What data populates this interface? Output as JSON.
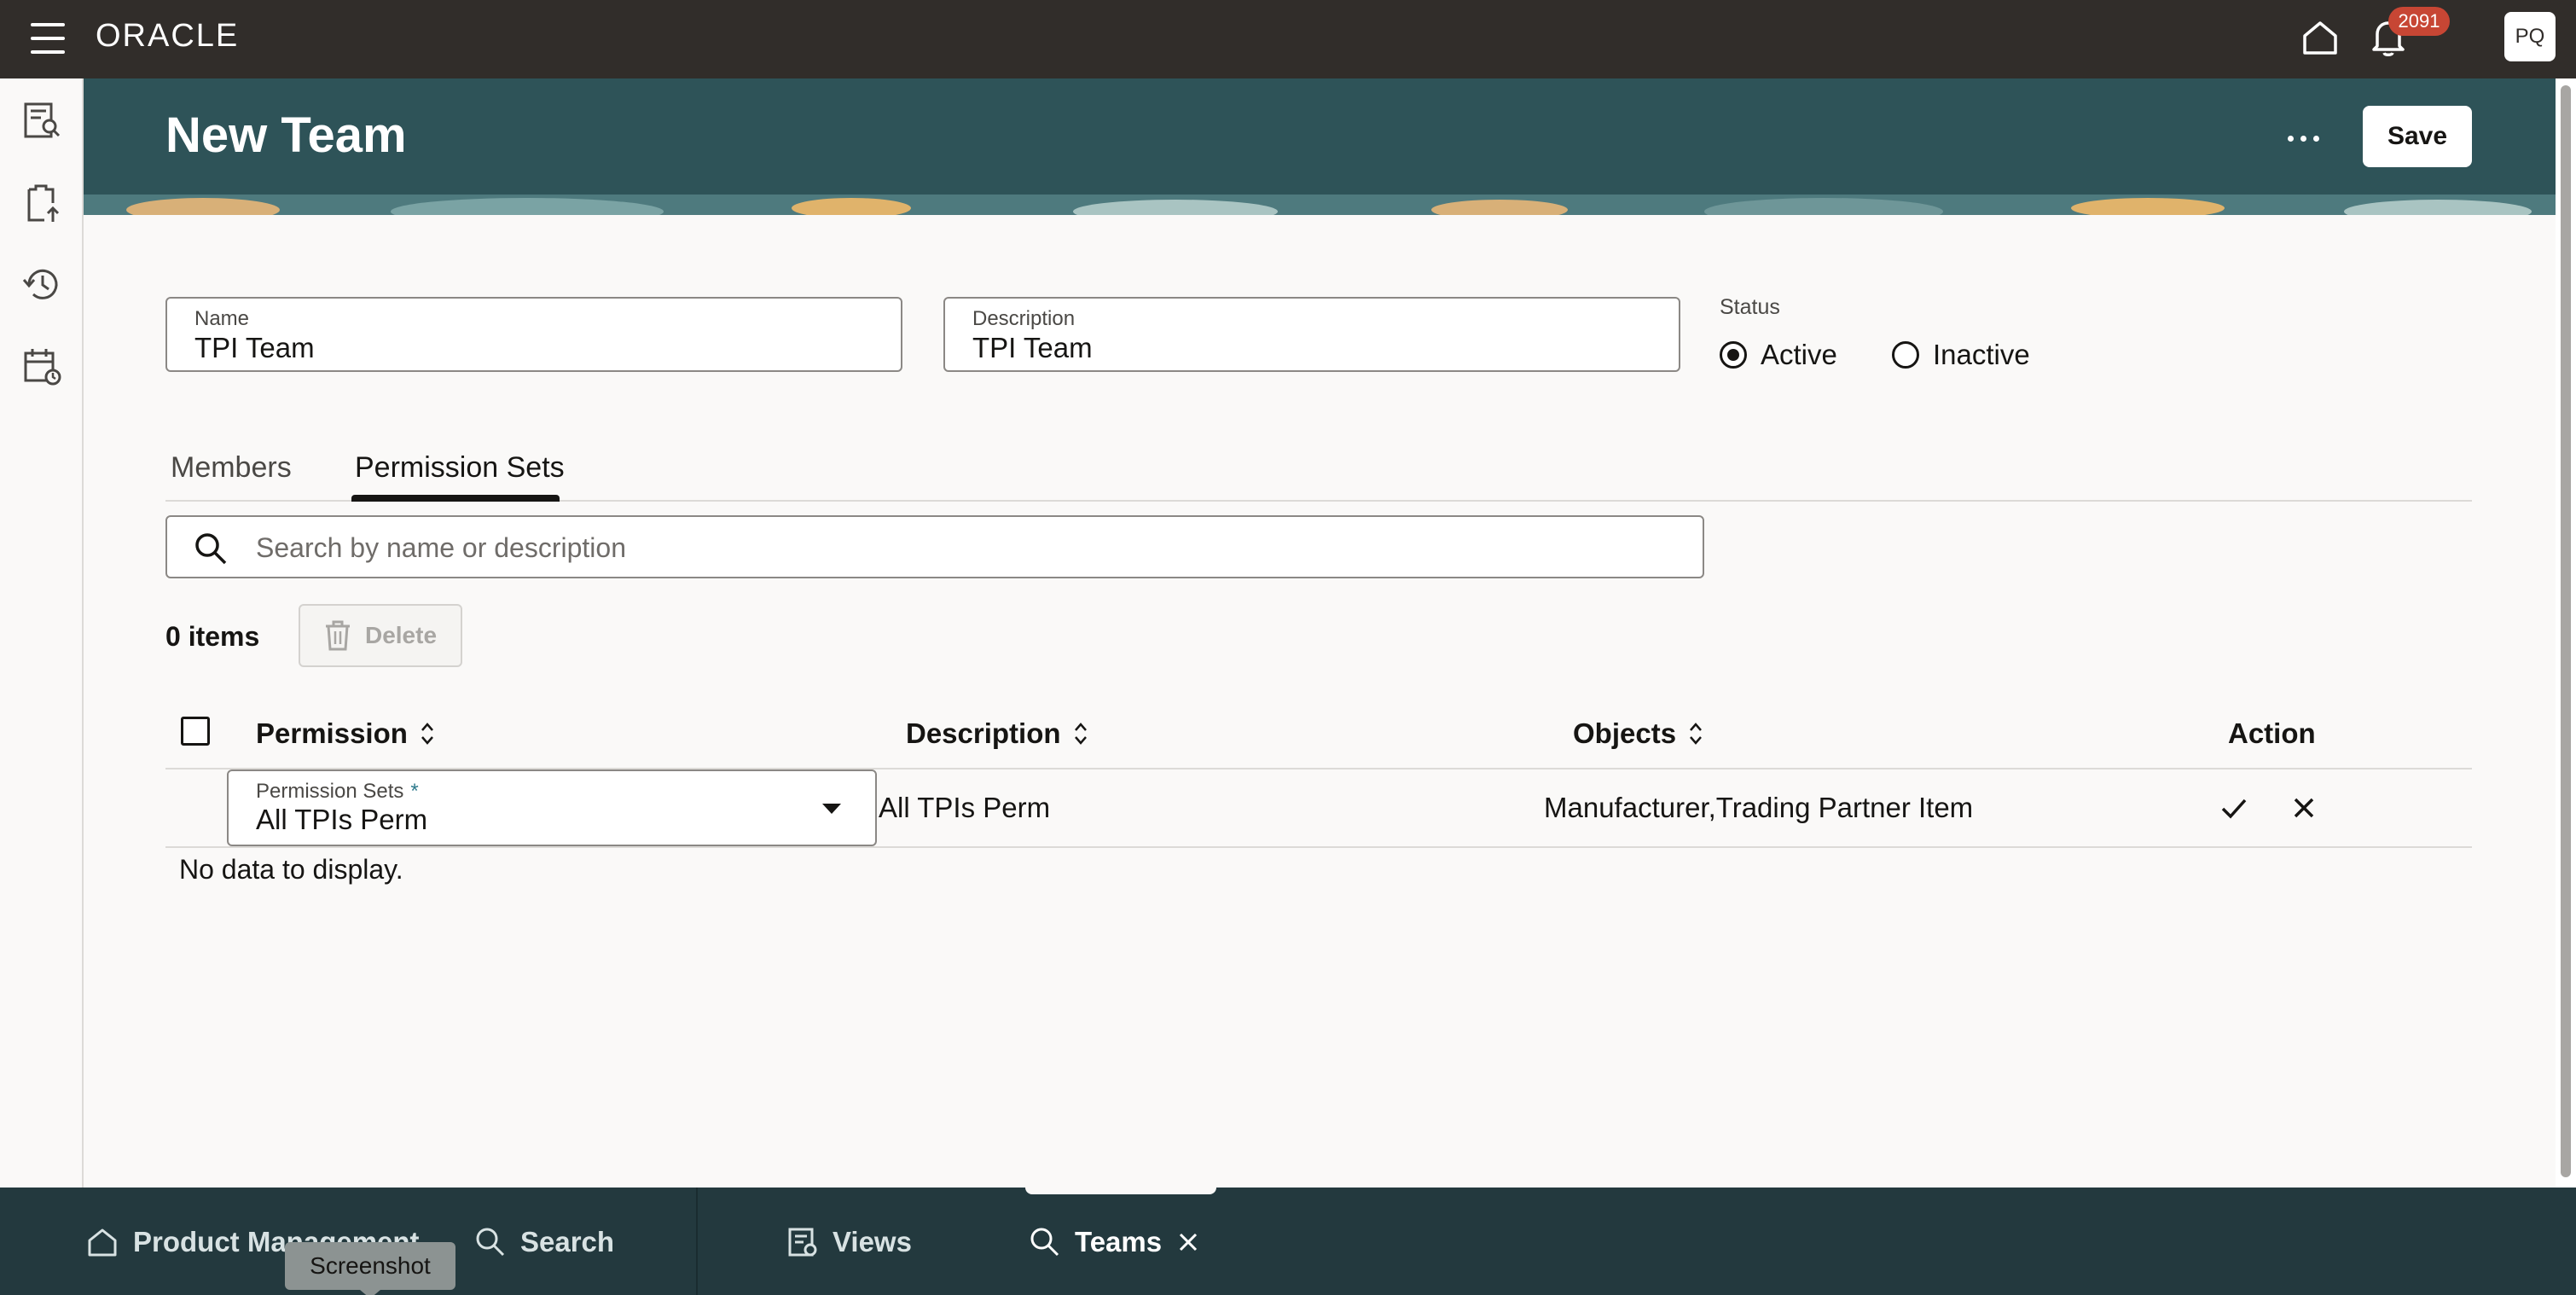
{
  "topbar": {
    "logo": "ORACLE",
    "notifications_count": "2091",
    "user_initials": "PQ"
  },
  "header": {
    "title": "New Team",
    "save_label": "Save"
  },
  "form": {
    "name": {
      "label": "Name",
      "value": "TPI Team"
    },
    "description": {
      "label": "Description",
      "value": "TPI Team"
    },
    "status": {
      "label": "Status",
      "options": [
        {
          "label": "Active",
          "selected": true
        },
        {
          "label": "Inactive",
          "selected": false
        }
      ]
    }
  },
  "tabs": [
    {
      "label": "Members",
      "active": false
    },
    {
      "label": "Permission Sets",
      "active": true
    }
  ],
  "search": {
    "placeholder": "Search by name or description"
  },
  "toolbar": {
    "items_count": "0 items",
    "delete_label": "Delete"
  },
  "table": {
    "columns": [
      "Permission",
      "Description",
      "Objects",
      "Action"
    ],
    "edit_row": {
      "select_label": "Permission Sets",
      "required_marker": "*",
      "select_value": "All TPIs Perm",
      "description": "All TPIs Perm",
      "objects": "Manufacturer,Trading Partner Item"
    },
    "empty_text": "No data to display."
  },
  "bottombar": {
    "items": [
      {
        "label": "Product Management"
      },
      {
        "label": "Search"
      },
      {
        "label": "Views"
      },
      {
        "label": "Teams"
      }
    ],
    "tooltip": "Screenshot"
  },
  "colors": {
    "topbar": "#312d2a",
    "header": "#2e5358",
    "bottombar": "#23393e",
    "badge": "#c74634"
  }
}
